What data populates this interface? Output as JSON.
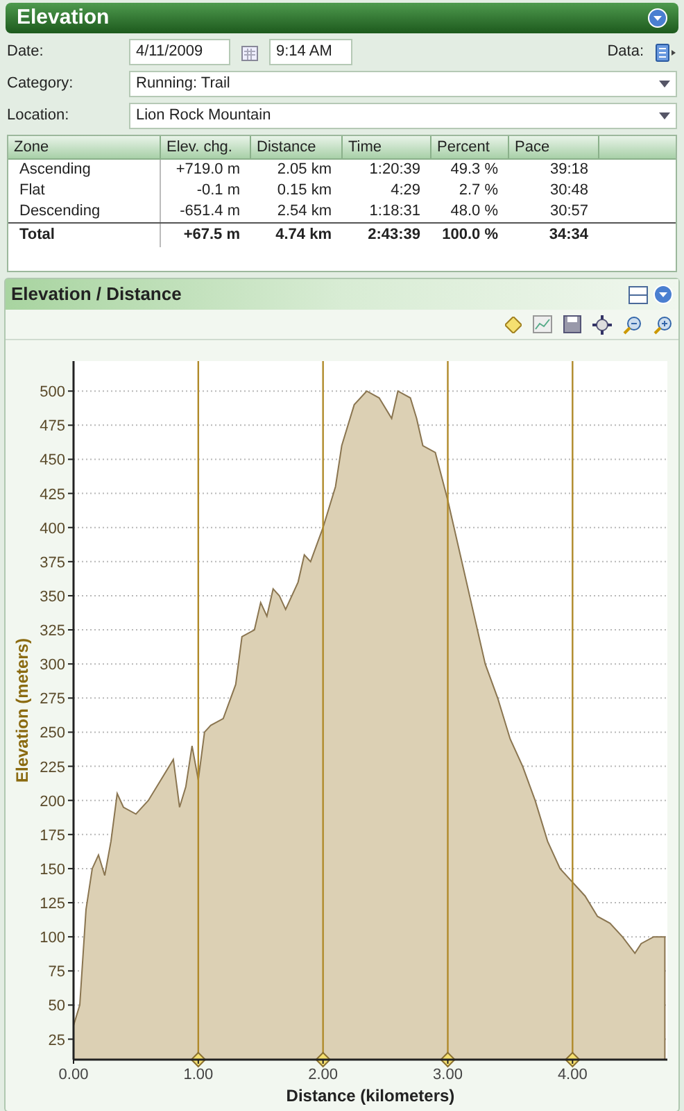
{
  "panel": {
    "title": "Elevation"
  },
  "form": {
    "date_label": "Date:",
    "date": "4/11/2009",
    "time": "9:14 AM",
    "data_label": "Data:",
    "category_label": "Category:",
    "category": "Running: Trail",
    "location_label": "Location:",
    "location": "Lion Rock Mountain"
  },
  "table": {
    "columns": [
      "Zone",
      "Elev. chg.",
      "Distance",
      "Time",
      "Percent",
      "Pace"
    ],
    "rows": [
      {
        "kind": "normal",
        "cells": [
          "Ascending",
          "+719.0 m",
          "2.05 km",
          "1:20:39",
          "49.3 %",
          "39:18"
        ]
      },
      {
        "kind": "normal",
        "cells": [
          "Flat",
          "-0.1 m",
          "0.15 km",
          "4:29",
          "2.7 %",
          "30:48"
        ]
      },
      {
        "kind": "normal",
        "cells": [
          "Descending",
          "-651.4 m",
          "2.54 km",
          "1:18:31",
          "48.0 %",
          "30:57"
        ]
      },
      {
        "kind": "total",
        "cells": [
          "Total",
          "+67.5 m",
          "4.74 km",
          "2:43:39",
          "100.0 %",
          "34:34"
        ]
      }
    ]
  },
  "chart_panel": {
    "title": "Elevation / Distance",
    "chart_data": {
      "type": "area",
      "xlabel": "Distance (kilometers)",
      "ylabel": "Elevation (meters)",
      "x": [
        0,
        0.05,
        0.1,
        0.15,
        0.2,
        0.25,
        0.3,
        0.35,
        0.4,
        0.5,
        0.6,
        0.7,
        0.8,
        0.85,
        0.9,
        0.95,
        1.0,
        1.05,
        1.1,
        1.2,
        1.3,
        1.35,
        1.45,
        1.5,
        1.55,
        1.6,
        1.65,
        1.7,
        1.8,
        1.85,
        1.9,
        2.0,
        2.1,
        2.15,
        2.25,
        2.35,
        2.45,
        2.55,
        2.6,
        2.7,
        2.75,
        2.8,
        2.9,
        3.0,
        3.1,
        3.2,
        3.3,
        3.4,
        3.5,
        3.6,
        3.7,
        3.8,
        3.9,
        4.0,
        4.1,
        4.2,
        4.3,
        4.4,
        4.5,
        4.55,
        4.65,
        4.74
      ],
      "grid": true,
      "series": [
        {
          "color": "#dcd0b4",
          "values": [
            35,
            50,
            120,
            150,
            160,
            145,
            170,
            205,
            195,
            190,
            200,
            215,
            230,
            195,
            210,
            240,
            215,
            250,
            255,
            260,
            285,
            320,
            325,
            345,
            335,
            355,
            350,
            340,
            360,
            380,
            375,
            400,
            430,
            460,
            490,
            500,
            495,
            480,
            500,
            495,
            480,
            460,
            455,
            420,
            380,
            340,
            300,
            275,
            245,
            225,
            200,
            170,
            150,
            140,
            130,
            115,
            110,
            100,
            88,
            95,
            100,
            100
          ]
        }
      ],
      "xlim": [
        0,
        4.76
      ],
      "ylim": [
        10,
        522
      ],
      "xticks": [
        {
          "value": 0,
          "label": "0.00"
        },
        {
          "value": 1,
          "label": "1.00"
        },
        {
          "value": 2,
          "label": "2.00"
        },
        {
          "value": 3,
          "label": "3.00"
        },
        {
          "value": 4,
          "label": "4.00"
        }
      ],
      "yticks": [
        25,
        50,
        75,
        100,
        125,
        150,
        175,
        200,
        225,
        250,
        275,
        300,
        325,
        350,
        375,
        400,
        425,
        450,
        475,
        500
      ]
    }
  }
}
